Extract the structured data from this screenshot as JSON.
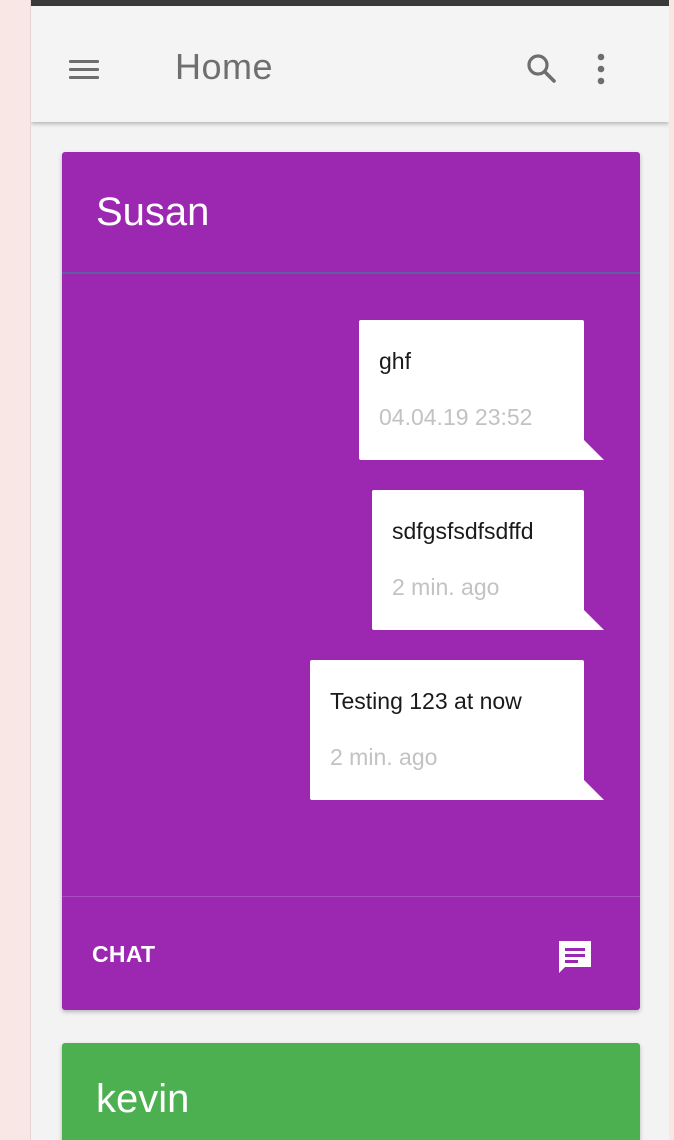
{
  "appbar": {
    "title": "Home",
    "icons": [
      "menu-icon",
      "search-icon",
      "more-vert-icon"
    ]
  },
  "cards": [
    {
      "name": "Susan",
      "color": "#9c27b0",
      "messages": [
        {
          "text": "ghf",
          "time": "04.04.19 23:52"
        },
        {
          "text": "sdfgsfsdfsdffd",
          "time": "2 min. ago"
        },
        {
          "text": "Testing 123 at now",
          "time": "2 min. ago"
        }
      ],
      "footer": {
        "chat_label": "CHAT",
        "icon": "chat-icon"
      }
    },
    {
      "name": "kevin",
      "color": "#4caf50"
    }
  ]
}
